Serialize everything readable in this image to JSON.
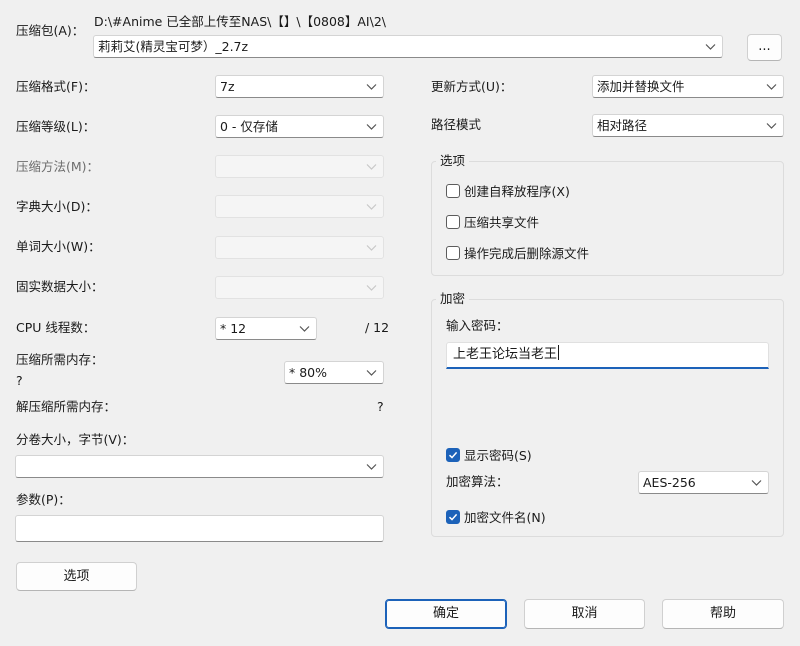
{
  "archive": {
    "label": "压缩包(A)：",
    "path": "D:\\#Anime 已全部上传至NAS\\【】\\【0808】AI\\2\\",
    "name": "莉莉艾(精灵宝可梦）_2.7z",
    "browse": "..."
  },
  "left": {
    "format": {
      "label": "压缩格式(F)：",
      "value": "7z"
    },
    "level": {
      "label": "压缩等级(L)：",
      "value": "0 - 仅存储"
    },
    "method": {
      "label": "压缩方法(M)：",
      "value": ""
    },
    "dict": {
      "label": "字典大小(D)：",
      "value": ""
    },
    "word": {
      "label": "单词大小(W)：",
      "value": ""
    },
    "solid": {
      "label": "固实数据大小：",
      "value": ""
    },
    "cpu": {
      "label": "CPU 线程数：",
      "value": "* 12",
      "total": "/ 12"
    },
    "mem": {
      "label": "压缩所需内存：",
      "value": "* 80%",
      "unknown": "?"
    },
    "demem": {
      "label": "解压缩所需内存：",
      "unknown": "?"
    },
    "volume": {
      "label": "分卷大小，字节(V)：",
      "value": ""
    },
    "params": {
      "label": "参数(P)：",
      "value": ""
    },
    "options_button": "选项"
  },
  "right": {
    "update": {
      "label": "更新方式(U)：",
      "value": "添加并替换文件"
    },
    "pathmode": {
      "label": "路径模式",
      "value": "相对路径"
    },
    "options": {
      "title": "选项",
      "sfx": {
        "label": "创建自释放程序(X)",
        "checked": false
      },
      "shared": {
        "label": "压缩共享文件",
        "checked": false
      },
      "delete": {
        "label": "操作完成后删除源文件",
        "checked": false
      }
    },
    "encryption": {
      "title": "加密",
      "password_label": "输入密码：",
      "password_value": "上老王论坛当老王",
      "show_password": {
        "label": "显示密码(S)",
        "checked": true
      },
      "method_label": "加密算法：",
      "method_value": "AES-256",
      "encrypt_names": {
        "label": "加密文件名(N)",
        "checked": true
      }
    }
  },
  "buttons": {
    "ok": "确定",
    "cancel": "取消",
    "help": "帮助"
  },
  "colors": {
    "accent": "#1c62b9",
    "background": "#f0f0f0"
  }
}
